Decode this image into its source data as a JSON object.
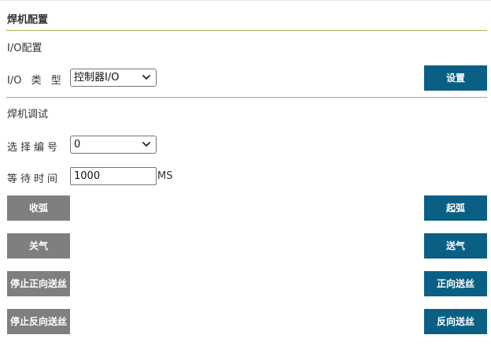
{
  "welder_config": {
    "title": "焊机配置",
    "io_section": {
      "heading": "I/O配置",
      "io_type_label": "I/O 类 型",
      "io_type_value": "控制器I/O",
      "set_button": "设置"
    },
    "debug_section": {
      "heading": "焊机调试",
      "select_number_label": "选择编号",
      "select_number_value": "0",
      "wait_time_label": "等待时间",
      "wait_time_value": "1000",
      "wait_time_unit": "MS"
    },
    "buttons": {
      "arc_off": "收弧",
      "arc_on": "起弧",
      "gas_off": "关气",
      "gas_on": "送气",
      "stop_forward_feed": "停止正向送丝",
      "forward_feed": "正向送丝",
      "stop_reverse_feed": "停止反向送丝",
      "reverse_feed": "反向送丝"
    }
  },
  "colors": {
    "divider": "#9cbf4a",
    "gray_button": "#7f7f7f",
    "blue_button": "#0a5f85"
  },
  "icons": {
    "dropdown": "chevron-down-icon"
  }
}
